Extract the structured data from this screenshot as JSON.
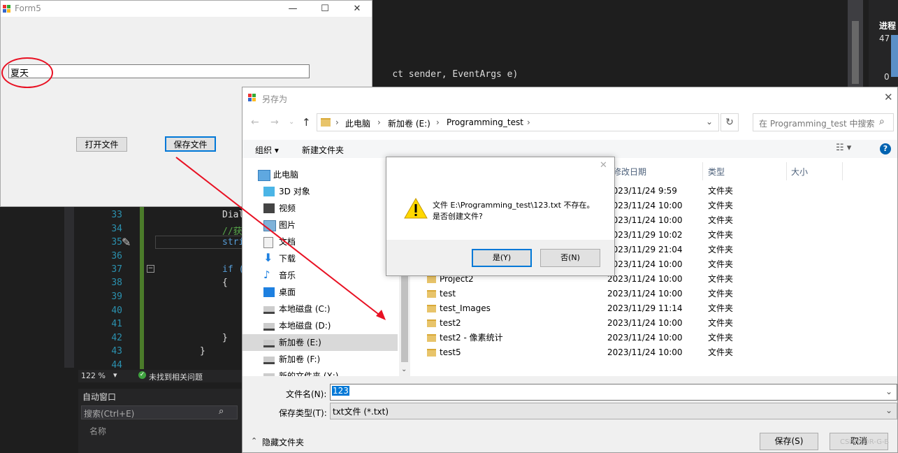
{
  "vs": {
    "code_fragment": "ct sender, EventArgs e)",
    "line_numbers": [
      "33",
      "34",
      "35",
      "36",
      "37",
      "38",
      "39",
      "40",
      "41",
      "42",
      "43",
      "44"
    ],
    "code_lines": [
      "Dial",
      "//获",
      "stri",
      "",
      "if (",
      "{",
      "",
      "",
      "",
      "}",
      "}",
      ""
    ],
    "zoom": "122 %",
    "status": "未找到相关问题",
    "auto_window_title": "自动窗口",
    "search_placeholder": "搜索(Ctrl+E)",
    "name_column": "名称",
    "right_panel_title": "进程",
    "right_values": [
      "47",
      "0"
    ]
  },
  "form5": {
    "title": "Form5",
    "textbox_value": "夏天",
    "open_button": "打开文件",
    "save_button": "保存文件"
  },
  "saveas": {
    "title": "另存为",
    "breadcrumb": [
      "此电脑",
      "新加卷 (E:)",
      "Programming_test"
    ],
    "search_placeholder": "在 Programming_test 中搜索",
    "organize": "组织 ▾",
    "new_folder": "新建文件夹",
    "nav": [
      {
        "label": "此电脑",
        "icon": "computer-icon"
      },
      {
        "label": "3D 对象",
        "icon": "3d-objects-icon"
      },
      {
        "label": "视频",
        "icon": "video-icon"
      },
      {
        "label": "图片",
        "icon": "pictures-icon"
      },
      {
        "label": "文档",
        "icon": "documents-icon"
      },
      {
        "label": "下载",
        "icon": "download-icon"
      },
      {
        "label": "音乐",
        "icon": "music-icon"
      },
      {
        "label": "桌面",
        "icon": "desktop-icon"
      },
      {
        "label": "本地磁盘 (C:)",
        "icon": "drive-icon"
      },
      {
        "label": "本地磁盘 (D:)",
        "icon": "drive-icon"
      },
      {
        "label": "新加卷 (E:)",
        "icon": "drive-icon"
      },
      {
        "label": "新加卷 (F:)",
        "icon": "drive-icon"
      },
      {
        "label": "新的文件夹 (X:)",
        "icon": "drive-icon"
      }
    ],
    "columns": {
      "modified": "修改日期",
      "type": "类型",
      "size": "大小"
    },
    "hidden_rows": [
      {
        "date": "2023/11/24 9:59",
        "type": "文件夹"
      },
      {
        "date": "2023/11/24 10:00",
        "type": "文件夹"
      },
      {
        "date": "2023/11/24 10:00",
        "type": "文件夹"
      },
      {
        "date": "2023/11/29 10:02",
        "type": "文件夹"
      },
      {
        "date": "2023/11/29 21:04",
        "type": "文件夹"
      },
      {
        "date": "2023/11/24 10:00",
        "type": "文件夹"
      }
    ],
    "files": [
      {
        "name": "Project2",
        "date": "2023/11/24 10:00",
        "type": "文件夹"
      },
      {
        "name": "test",
        "date": "2023/11/24 10:00",
        "type": "文件夹"
      },
      {
        "name": "test_Images",
        "date": "2023/11/29 11:14",
        "type": "文件夹"
      },
      {
        "name": "test2",
        "date": "2023/11/24 10:00",
        "type": "文件夹"
      },
      {
        "name": "test2 - 像素统计",
        "date": "2023/11/24 10:00",
        "type": "文件夹"
      },
      {
        "name": "test5",
        "date": "2023/11/24 10:00",
        "type": "文件夹"
      }
    ],
    "filename_label": "文件名(N):",
    "filename_value": "123",
    "filetype_label": "保存类型(T):",
    "filetype_value": "txt文件 (*.txt)",
    "hide_folders": "隐藏文件夹",
    "save_button": "保存(S)",
    "cancel_button": "取消"
  },
  "msgbox": {
    "line1": "文件 E:\\Programming_test\\123.txt 不存在。",
    "line2": "是否创建文件?",
    "yes": "是(Y)",
    "no": "否(N)"
  },
  "watermark": "CSDN @R-G-B",
  "colors": {
    "annotation": "#e81123",
    "accent": "#0078d7",
    "selected_nav": "#cce8ff"
  }
}
